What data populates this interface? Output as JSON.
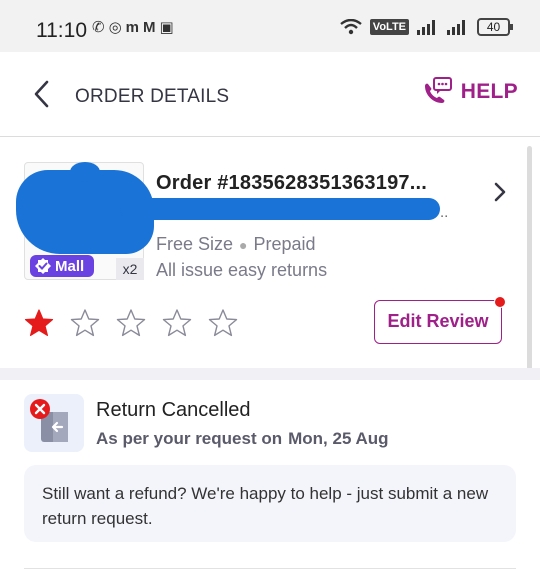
{
  "status_bar": {
    "time": "11:10",
    "network": "VoLTE",
    "battery": "40"
  },
  "header": {
    "title": "ORDER DETAILS",
    "help_label": "HELP"
  },
  "order": {
    "number": "Order #1835628351363197...",
    "subtitle_tail": "..",
    "size": "Free Size",
    "payment": "Prepaid",
    "returns_note": "All issue easy returns",
    "badge": "Mall",
    "quantity": "x2",
    "rating": {
      "value": 1,
      "max": 5
    },
    "edit_review_label": "Edit Review"
  },
  "return_status": {
    "title": "Return Cancelled",
    "reason": "As per your request on",
    "date": "Mon, 25 Aug",
    "refund_message": "Still want a refund? We're happy to help - just submit a new return request."
  },
  "colors": {
    "brand": "#9f2089",
    "mall_badge": "#6a42e2",
    "star_filled": "#e51a1a",
    "redaction": "#1a73d6"
  },
  "icons": {
    "back": "chevron-left-icon",
    "help": "phone-chat-icon",
    "order_open": "chevron-right-icon",
    "mall": "verified-check-icon",
    "return": "cancelled-return-icon"
  }
}
